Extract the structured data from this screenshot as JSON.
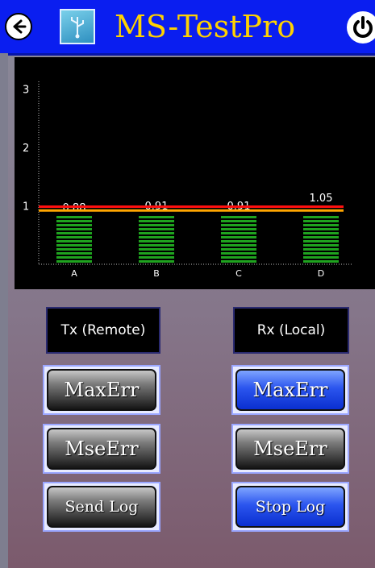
{
  "app": {
    "title": "MS-TestPro",
    "back_icon": "back-arrow-icon",
    "app_icon": "usb-icon",
    "power_icon": "power-icon"
  },
  "colors": {
    "titlebar": "#0a1ef0",
    "title_text": "#ffd200",
    "bars": "#1fa31f",
    "threshold_red": "#ff1010",
    "threshold_orange": "#ffa500"
  },
  "chart_data": {
    "type": "bar",
    "categories": [
      "A",
      "B",
      "C",
      "D"
    ],
    "values": [
      0.88,
      0.91,
      0.91,
      1.05
    ],
    "value_labels": [
      "0.88",
      "0.91",
      "0.91",
      "1.05"
    ],
    "y_ticks": [
      "1",
      "2",
      "3"
    ],
    "ylim": [
      0,
      3.3
    ],
    "threshold_lines": [
      1.0,
      0.92
    ],
    "grid": false
  },
  "panels": {
    "tx_label": "Tx (Remote)",
    "rx_label": "Rx (Local)"
  },
  "buttons": {
    "tx_maxerr": "MaxErr",
    "tx_mseerr": "MseErr",
    "tx_sendlog": "Send Log",
    "rx_maxerr": "MaxErr",
    "rx_mseerr": "MseErr",
    "rx_stoplog": "Stop Log"
  }
}
